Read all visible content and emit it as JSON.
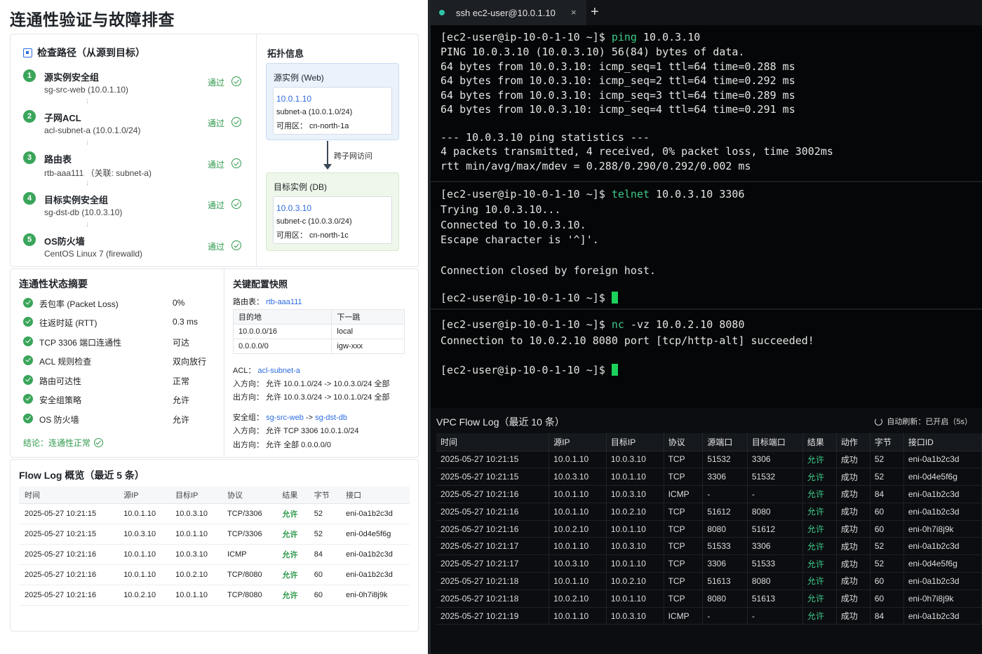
{
  "page_title": "连通性验证与故障排查",
  "check_path": {
    "title": "检查路径（从源到目标）",
    "steps": [
      {
        "num": "1",
        "title": "源实例安全组",
        "sub": "sg-src-web (10.0.1.10)",
        "status": "通过"
      },
      {
        "num": "2",
        "title": "子网ACL",
        "sub": "acl-subnet-a (10.0.1.0/24)",
        "status": "通过"
      },
      {
        "num": "3",
        "title": "路由表",
        "sub": "rtb-aaa111 （关联: subnet-a)",
        "status": "通过"
      },
      {
        "num": "4",
        "title": "目标实例安全组",
        "sub": "sg-dst-db (10.0.3.10)",
        "status": "通过"
      },
      {
        "num": "5",
        "title": "OS防火墙",
        "sub": "CentOS Linux 7 (firewalld)",
        "status": "通过"
      }
    ],
    "arrow": "↓"
  },
  "topology": {
    "title": "拓扑信息",
    "source": {
      "title": "源实例 (Web)",
      "ip": "10.0.1.10",
      "subnet": "subnet-a (10.0.1.0/24)",
      "az": "可用区： cn-north-1a"
    },
    "cross_label": "跨子网访问",
    "target": {
      "title": "目标实例 (DB)",
      "ip": "10.0.3.10",
      "subnet": "subnet-c (10.0.3.0/24)",
      "az": "可用区： cn-north-1c"
    }
  },
  "summary": {
    "title": "连通性状态摘要",
    "rows": [
      {
        "label": "丢包率 (Packet Loss)",
        "value": "0%"
      },
      {
        "label": "往返时延 (RTT)",
        "value": "0.3 ms"
      },
      {
        "label": "TCP 3306 端口连通性",
        "value": "可达"
      },
      {
        "label": "ACL 规则检查",
        "value": "双向放行"
      },
      {
        "label": "路由可达性",
        "value": "正常"
      },
      {
        "label": "安全组策略",
        "value": "允许"
      },
      {
        "label": "OS 防火墙",
        "value": "允许"
      }
    ],
    "conclusion": "结论：连通性正常"
  },
  "config": {
    "title": "关键配置快照",
    "route_label": "路由表：",
    "route_id": "rtb-aaa111",
    "route_table": {
      "headers": [
        "目的地",
        "下一跳"
      ],
      "rows": [
        [
          "10.0.0.0/16",
          "local"
        ],
        [
          "0.0.0.0/0",
          "igw-xxx"
        ]
      ]
    },
    "acl_label": "ACL：",
    "acl_id": "acl-subnet-a",
    "acl_in": "入方向：  允许  10.0.1.0/24  ->  10.0.3.0/24  全部",
    "acl_out": "出方向：  允许  10.0.3.0/24  ->  10.0.1.0/24  全部",
    "sg_label": "安全组：",
    "sg_src": "sg-src-web",
    "sg_arrow": " -> ",
    "sg_dst": "sg-dst-db",
    "sg_in": "入方向：  允许  TCP  3306  10.0.1.0/24",
    "sg_out": "出方向：  允许  全部    0.0.0.0/0"
  },
  "flow_overview": {
    "title": "Flow Log 概览（最近 5 条）",
    "headers": [
      "时间",
      "源IP",
      "目标IP",
      "协议",
      "结果",
      "字节",
      "接口"
    ],
    "rows": [
      [
        "2025-05-27 10:21:15",
        "10.0.1.10",
        "10.0.3.10",
        "TCP/3306",
        "允许",
        "52",
        "eni-0a1b2c3d"
      ],
      [
        "2025-05-27 10:21:15",
        "10.0.3.10",
        "10.0.1.10",
        "TCP/3306",
        "允许",
        "52",
        "eni-0d4e5f6g"
      ],
      [
        "2025-05-27 10:21:16",
        "10.0.1.10",
        "10.0.3.10",
        "ICMP",
        "允许",
        "84",
        "eni-0a1b2c3d"
      ],
      [
        "2025-05-27 10:21:16",
        "10.0.1.10",
        "10.0.2.10",
        "TCP/8080",
        "允许",
        "60",
        "eni-0a1b2c3d"
      ],
      [
        "2025-05-27 10:21:16",
        "10.0.2.10",
        "10.0.1.10",
        "TCP/8080",
        "允许",
        "60",
        "eni-0h7i8j9k"
      ]
    ]
  },
  "terminal": {
    "tab_title": "ssh ec2-user@10.0.1.10",
    "tab_close": "×",
    "tab_plus": "+",
    "prompt": "[ec2-user@ip-10-0-1-10 ~]$ ",
    "ping": {
      "cmd": "ping",
      "args": " 10.0.3.10",
      "lines": [
        "PING 10.0.3.10 (10.0.3.10) 56(84) bytes of data.",
        "64 bytes from 10.0.3.10: icmp_seq=1 ttl=64 time=0.288 ms",
        "64 bytes from 10.0.3.10: icmp_seq=2 ttl=64 time=0.292 ms",
        "64 bytes from 10.0.3.10: icmp_seq=3 ttl=64 time=0.289 ms",
        "64 bytes from 10.0.3.10: icmp_seq=4 ttl=64 time=0.291 ms",
        "",
        "--- 10.0.3.10 ping statistics ---",
        "4 packets transmitted, 4 received, 0% packet loss, time 3002ms",
        "rtt min/avg/max/mdev = 0.288/0.290/0.292/0.002 ms"
      ]
    },
    "telnet": {
      "cmd": "telnet",
      "args": " 10.0.3.10 3306",
      "lines": [
        "Trying 10.0.3.10...",
        "Connected to 10.0.3.10.",
        "Escape character is '^]'.",
        "",
        "Connection closed by foreign host."
      ]
    },
    "nc": {
      "cmd": "nc",
      "args": " -vz 10.0.2.10 8080",
      "lines": [
        "Connection to 10.0.2.10 8080 port [tcp/http-alt] succeeded!"
      ]
    }
  },
  "vpc_flow": {
    "title": "VPC Flow Log（最近 10 条）",
    "refresh": "自动刷新：已开启（5s）",
    "headers": [
      "时间",
      "源IP",
      "目标IP",
      "协议",
      "源端口",
      "目标端口",
      "结果",
      "动作",
      "字节",
      "接口ID"
    ],
    "rows": [
      [
        "2025-05-27 10:21:15",
        "10.0.1.10",
        "10.0.3.10",
        "TCP",
        "51532",
        "3306",
        "允许",
        "成功",
        "52",
        "eni-0a1b2c3d"
      ],
      [
        "2025-05-27 10:21:15",
        "10.0.3.10",
        "10.0.1.10",
        "TCP",
        "3306",
        "51532",
        "允许",
        "成功",
        "52",
        "eni-0d4e5f6g"
      ],
      [
        "2025-05-27 10:21:16",
        "10.0.1.10",
        "10.0.3.10",
        "ICMP",
        "-",
        "-",
        "允许",
        "成功",
        "84",
        "eni-0a1b2c3d"
      ],
      [
        "2025-05-27 10:21:16",
        "10.0.1.10",
        "10.0.2.10",
        "TCP",
        "51612",
        "8080",
        "允许",
        "成功",
        "60",
        "eni-0a1b2c3d"
      ],
      [
        "2025-05-27 10:21:16",
        "10.0.2.10",
        "10.0.1.10",
        "TCP",
        "8080",
        "51612",
        "允许",
        "成功",
        "60",
        "eni-0h7i8j9k"
      ],
      [
        "2025-05-27 10:21:17",
        "10.0.1.10",
        "10.0.3.10",
        "TCP",
        "51533",
        "3306",
        "允许",
        "成功",
        "52",
        "eni-0a1b2c3d"
      ],
      [
        "2025-05-27 10:21:17",
        "10.0.3.10",
        "10.0.1.10",
        "TCP",
        "3306",
        "51533",
        "允许",
        "成功",
        "52",
        "eni-0d4e5f6g"
      ],
      [
        "2025-05-27 10:21:18",
        "10.0.1.10",
        "10.0.2.10",
        "TCP",
        "51613",
        "8080",
        "允许",
        "成功",
        "60",
        "eni-0a1b2c3d"
      ],
      [
        "2025-05-27 10:21:18",
        "10.0.2.10",
        "10.0.1.10",
        "TCP",
        "8080",
        "51613",
        "允许",
        "成功",
        "60",
        "eni-0h7i8j9k"
      ],
      [
        "2025-05-27 10:21:19",
        "10.0.1.10",
        "10.0.3.10",
        "ICMP",
        "-",
        "-",
        "允许",
        "成功",
        "84",
        "eni-0a1b2c3d"
      ]
    ]
  },
  "colors": {
    "accent_green": "#3aa55a",
    "link_blue": "#2d6cdf",
    "terminal_green": "#3ec98a",
    "cursor_green": "#1bd15a"
  }
}
